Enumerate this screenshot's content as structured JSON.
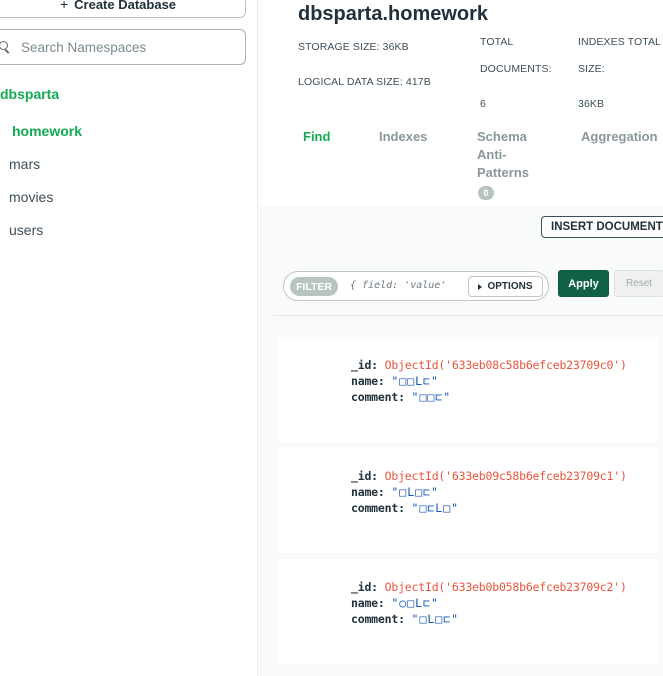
{
  "sidebar": {
    "create_database_label": "Create Database",
    "create_plus": "+",
    "search_placeholder": "Search Namespaces",
    "database": "dbsparta",
    "collections": [
      "homework",
      "mars",
      "movies",
      "users"
    ],
    "active_collection": "homework"
  },
  "header": {
    "namespace": "dbsparta.homework",
    "storage_size": "STORAGE SIZE: 36KB",
    "logical_data_size": "LOGICAL DATA SIZE: 417B",
    "total_documents_label_1": "TOTAL",
    "total_documents_label_2": "DOCUMENTS:",
    "total_documents_value": "6",
    "indexes_total_label_1": "INDEXES TOTAL",
    "indexes_total_label_2": "SIZE:",
    "indexes_total_value": "36KB"
  },
  "tabs": {
    "find": "Find",
    "indexes": "Indexes",
    "schema_1": "Schema",
    "schema_2": "Anti-",
    "schema_3": "Patterns",
    "schema_badge": "0",
    "aggregation": "Aggregation",
    "active": "Find"
  },
  "toolbar": {
    "insert_document": "INSERT DOCUMENT",
    "filter_label": "FILTER",
    "filter_placeholder": "{ field: 'value'",
    "options_label": "OPTIONS",
    "apply_label": "Apply",
    "reset_label": "Reset"
  },
  "documents": [
    {
      "id_key": "_id:",
      "id_value": "ObjectId('633eb08c58b6efceb23709c0')",
      "name_key": "name:",
      "name_value": "\"□□L⊏\"",
      "comment_key": "comment:",
      "comment_value": "\"□□⊏\""
    },
    {
      "id_key": "_id:",
      "id_value": "ObjectId('633eb09c58b6efceb23709c1')",
      "name_key": "name:",
      "name_value": "\"□L□⊏\"",
      "comment_key": "comment:",
      "comment_value": "\"□⊏L□\""
    },
    {
      "id_key": "_id:",
      "id_value": "ObjectId('633eb0b058b6efceb23709c2')",
      "name_key": "name:",
      "name_value": "\"○□L⊏\"",
      "comment_key": "comment:",
      "comment_value": "\"□L□⊏\""
    }
  ],
  "colors": {
    "accent_green": "#13aa52",
    "apply_bg": "#116149",
    "object_id": "#e8543c",
    "string_value": "#1254b7"
  }
}
